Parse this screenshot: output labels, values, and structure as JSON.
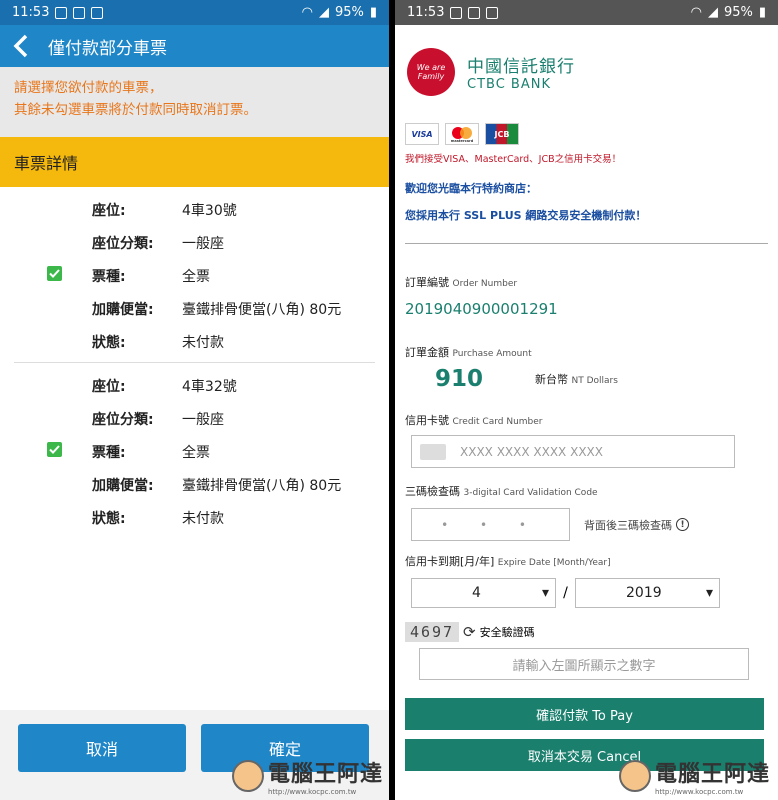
{
  "left": {
    "status": {
      "time": "11:53",
      "battery": "95%"
    },
    "appbar": {
      "title": "僅付款部分車票"
    },
    "notice": {
      "line1": "請選擇您欲付款的車票，",
      "line2": "其餘未勾選車票將於付款同時取消訂票。"
    },
    "section_title": "車票詳情",
    "labels": {
      "seat": "座位:",
      "seat_class": "座位分類:",
      "ticket_type": "票種:",
      "bento": "加購便當:",
      "status": "狀態:"
    },
    "tickets": [
      {
        "seat": "4車30號",
        "seat_class": "一般座",
        "ticket_type": "全票",
        "bento": "臺鐵排骨便當(八角) 80元",
        "status": "未付款"
      },
      {
        "seat": "4車32號",
        "seat_class": "一般座",
        "ticket_type": "全票",
        "bento": "臺鐵排骨便當(八角) 80元",
        "status": "未付款"
      }
    ],
    "buttons": {
      "cancel": "取消",
      "confirm": "確定"
    },
    "watermark": {
      "text": "電腦王阿達",
      "url": "http://www.kocpc.com.tw"
    }
  },
  "right": {
    "status": {
      "time": "11:53",
      "battery": "95%"
    },
    "bank": {
      "cn": "中國信託銀行",
      "en": "CTBC BANK",
      "logo": "We are Family"
    },
    "cards": [
      "VISA",
      "mastercard",
      "JCB"
    ],
    "accept_text": "我們接受VISA、MasterCard、JCB之信用卡交易！",
    "welcome1": "歡迎您光臨本行特約商店：",
    "welcome2": "您採用本行 SSL PLUS 網路交易安全機制付款！",
    "order": {
      "label": "訂單編號",
      "label_en": "Order Number",
      "value": "2019040900001291"
    },
    "amount": {
      "label": "訂單金額",
      "label_en": "Purchase Amount",
      "value": "910",
      "currency": "新台幣",
      "currency_en": "NT Dollars"
    },
    "card_no": {
      "label": "信用卡號",
      "label_en": "Credit Card Number",
      "placeholder": "XXXX XXXX XXXX XXXX"
    },
    "cvv": {
      "label": "三碼檢查碼",
      "label_en": "3-digital Card Validation Code",
      "placeholder": "• • •",
      "help": "背面後三碼檢查碼"
    },
    "expire": {
      "label": "信用卡到期[月/年]",
      "label_en": "Expire Date [Month/Year]",
      "month": "4",
      "year": "2019",
      "sep": "/"
    },
    "captcha": {
      "code": "4697",
      "label": "安全驗證碼",
      "placeholder": "請輸入左圖所顯示之數字"
    },
    "buttons": {
      "pay": "確認付款 To Pay",
      "cancel": "取消本交易 Cancel"
    },
    "watermark": {
      "text": "電腦王阿達",
      "url": "http://www.kocpc.com.tw"
    }
  }
}
